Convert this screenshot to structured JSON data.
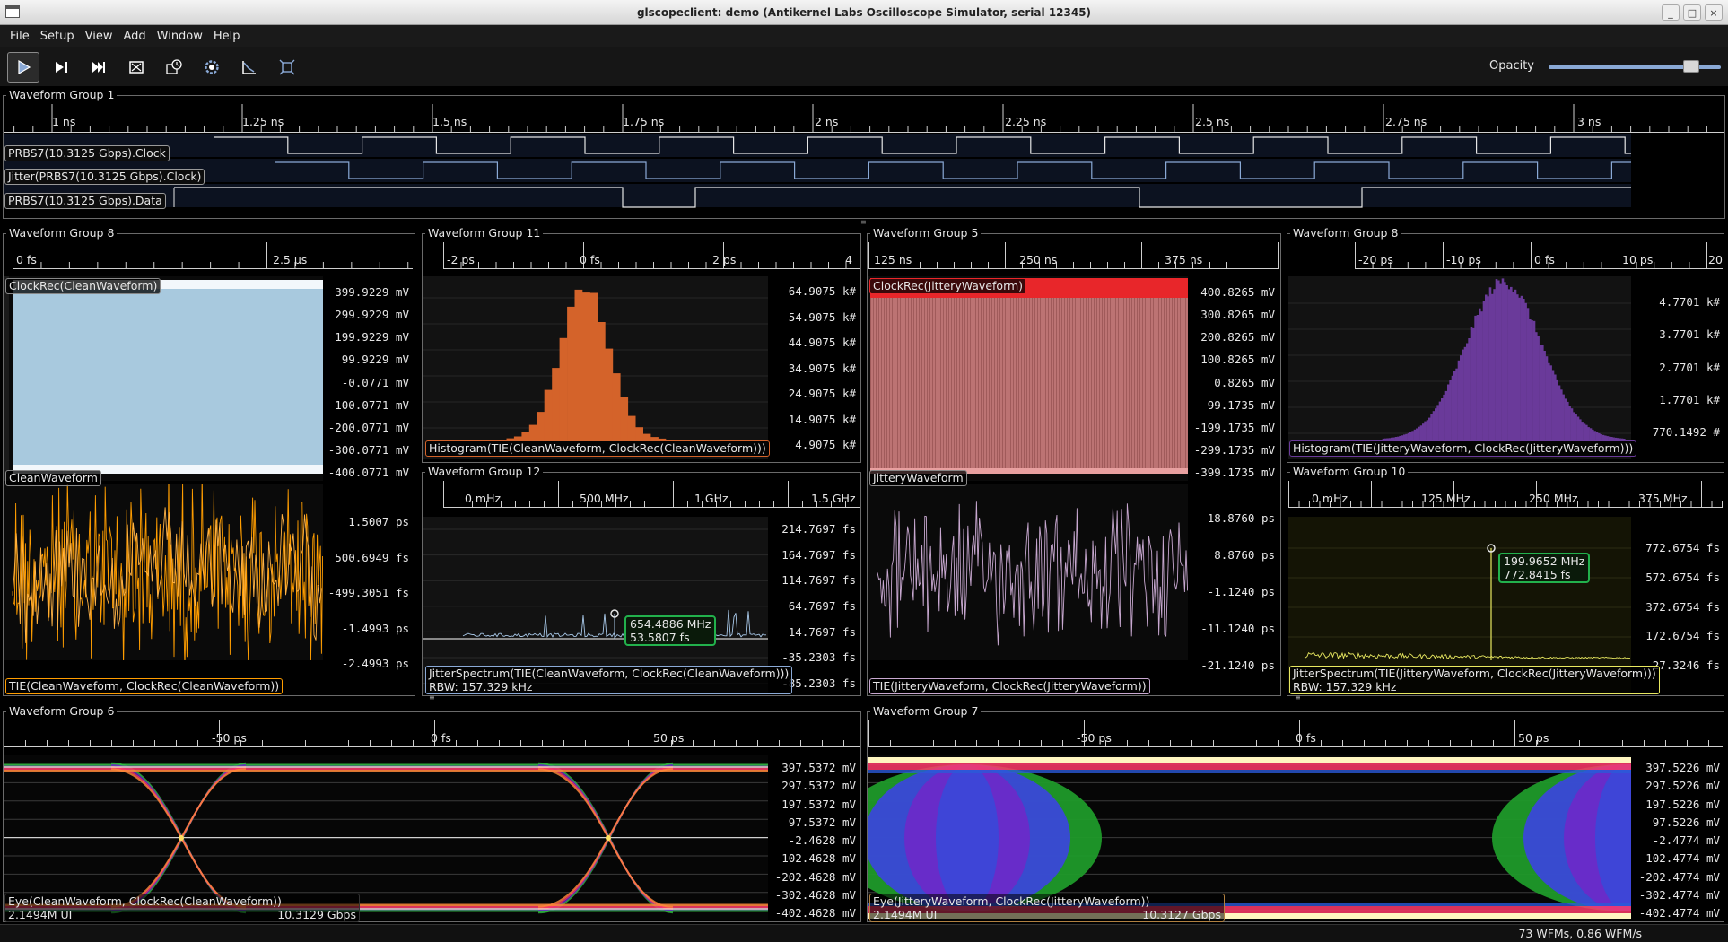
{
  "window": {
    "title": "glscopeclient: demo (Antikernel Labs Oscilloscope Simulator, serial 12345)",
    "controls": [
      "_",
      "□",
      "×"
    ]
  },
  "menu": [
    "File",
    "Setup",
    "View",
    "Add",
    "Window",
    "Help"
  ],
  "toolbar": {
    "buttons": [
      "start-trigger",
      "single-trigger",
      "force-trigger",
      "stop-trigger",
      "history",
      "refresh",
      "clear-sweeps",
      "fullscreen"
    ],
    "opacity_label": "Opacity",
    "opacity_value": 0.83
  },
  "groups": {
    "g1": {
      "title": "Waveform Group 1",
      "ticks": [
        "1 ns",
        "1.25 ns",
        "1.5 ns",
        "1.75 ns",
        "2 ns",
        "2.25 ns",
        "2.5 ns",
        "2.75 ns",
        "3 ns"
      ],
      "channels": [
        "PRBS7(10.3125 Gbps).Clock",
        "Jitter(PRBS7(10.3125 Gbps).Clock)",
        "PRBS7(10.3125 Gbps).Data"
      ]
    },
    "g8a": {
      "title": "Waveform Group 8",
      "ticks": [
        "0 fs",
        "2.5 µs"
      ],
      "top_label": "ClockRec(CleanWaveform)",
      "top_y": [
        "399.9229 mV",
        "299.9229 mV",
        "199.9229 mV",
        "99.9229 mV",
        "-0.0771 mV",
        "-100.0771 mV",
        "-200.0771 mV",
        "-300.0771 mV",
        "-400.0771 mV"
      ],
      "mid_label": "CleanWaveform",
      "bottom_y": [
        "1.5007 ps",
        "500.6949 fs",
        "-499.3051 fs",
        "-1.4993 ps",
        "-2.4993 ps"
      ],
      "bottom_label": "TIE(CleanWaveform, ClockRec(CleanWaveform))"
    },
    "g11": {
      "title": "Waveform Group 11",
      "ticks": [
        "-2 ps",
        "0 fs",
        "2 ps",
        "4"
      ],
      "y": [
        "64.9075 k#",
        "54.9075 k#",
        "44.9075 k#",
        "34.9075 k#",
        "24.9075 k#",
        "14.9075 k#",
        "4.9075 k#"
      ],
      "label": "Histogram(TIE(CleanWaveform, ClockRec(CleanWaveform)))"
    },
    "g12": {
      "title": "Waveform Group 12",
      "ticks": [
        "0 mHz",
        "500 MHz",
        "1 GHz",
        "1.5 GHz"
      ],
      "y": [
        "214.7697 fs",
        "164.7697 fs",
        "114.7697 fs",
        "64.7697 fs",
        "14.7697 fs",
        "-35.2303 fs",
        "-85.2303 fs"
      ],
      "label": "JitterSpectrum(TIE(CleanWaveform, ClockRec(CleanWaveform)))",
      "rbw": "RBW: 157.329 kHz",
      "marker_freq": "654.4886 MHz",
      "marker_val": "53.5807 fs"
    },
    "g5": {
      "title": "Waveform Group 5",
      "ticks": [
        "125 ns",
        "250 ns",
        "375 ns"
      ],
      "top_label": "ClockRec(JitteryWaveform)",
      "top_y": [
        "400.8265 mV",
        "300.8265 mV",
        "200.8265 mV",
        "100.8265 mV",
        "0.8265 mV",
        "-99.1735 mV",
        "-199.1735 mV",
        "-299.1735 mV",
        "-399.1735 mV"
      ],
      "mid_label": "JitteryWaveform",
      "bottom_y": [
        "18.8760 ps",
        "8.8760 ps",
        "-1.1240 ps",
        "-11.1240 ps",
        "-21.1240 ps"
      ],
      "bottom_label": "TIE(JitteryWaveform, ClockRec(JitteryWaveform))"
    },
    "g8b": {
      "title": "Waveform Group 8",
      "ticks": [
        "-20 ps",
        "-10 ps",
        "0 fs",
        "10 ps",
        "20"
      ],
      "y": [
        "4.7701 k#",
        "3.7701 k#",
        "2.7701 k#",
        "1.7701 k#",
        "770.1492 #"
      ],
      "label": "Histogram(TIE(JitteryWaveform, ClockRec(JitteryWaveform)))"
    },
    "g10": {
      "title": "Waveform Group 10",
      "ticks": [
        "0 mHz",
        "125 MHz",
        "250 MHz",
        "375 MHz"
      ],
      "y": [
        "772.6754 fs",
        "572.6754 fs",
        "372.6754 fs",
        "172.6754 fs",
        "-27.3246 fs"
      ],
      "label": "JitterSpectrum(TIE(JitteryWaveform, ClockRec(JitteryWaveform)))",
      "rbw": "RBW: 157.329 kHz",
      "marker_freq": "199.9652 MHz",
      "marker_val": "772.8415 fs"
    },
    "g6": {
      "title": "Waveform Group 6",
      "ticks": [
        "-50 ps",
        "0 fs",
        "50 ps"
      ],
      "y": [
        "397.5372 mV",
        "297.5372 mV",
        "197.5372 mV",
        "97.5372 mV",
        "-2.4628 mV",
        "-102.4628 mV",
        "-202.4628 mV",
        "-302.4628 mV",
        "-402.4628 mV"
      ],
      "label": "Eye(CleanWaveform, ClockRec(CleanWaveform))",
      "ui": "2.1494M UI",
      "rate": "10.3129 Gbps"
    },
    "g7": {
      "title": "Waveform Group 7",
      "ticks": [
        "-50 ps",
        "0 fs",
        "50 ps"
      ],
      "y": [
        "397.5226 mV",
        "297.5226 mV",
        "197.5226 mV",
        "97.5226 mV",
        "-2.4774 mV",
        "-102.4774 mV",
        "-202.4774 mV",
        "-302.4774 mV",
        "-402.4774 mV"
      ],
      "label": "Eye(JitteryWaveform, ClockRec(JitteryWaveform))",
      "ui": "2.1494M UI",
      "rate": "10.3127 Gbps"
    }
  },
  "status": "73 WFMs, 0.86 WFM/s",
  "colors": {
    "clock_blue": "#8aa9d6",
    "orange": "#ff9d00",
    "histogram_orange": "#d4632a",
    "histogram_purple": "#6a3a9a",
    "clockrec_red": "#e8262a",
    "jitter_pink": "#c8a8d0",
    "spectrum_yellow": "#e8e860",
    "marker_green": "#22b14c"
  }
}
